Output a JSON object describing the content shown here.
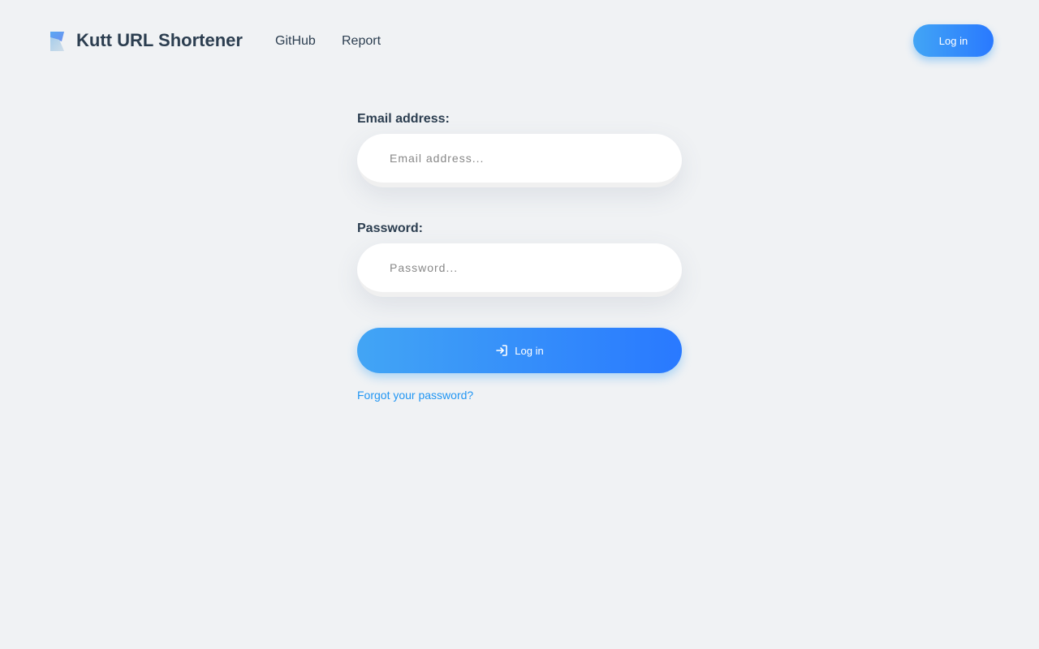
{
  "header": {
    "brand": "Kutt URL Shortener",
    "logo_icon": "kutt-logo-icon",
    "nav": [
      {
        "label": "GitHub"
      },
      {
        "label": "Report"
      }
    ],
    "login_label": "Log in"
  },
  "form": {
    "email": {
      "label": "Email address:",
      "value": "",
      "placeholder": "Email address..."
    },
    "password": {
      "label": "Password:",
      "value": "",
      "placeholder": "Password..."
    },
    "submit": {
      "label": "Log in",
      "icon": "login-icon"
    },
    "forgot_label": "Forgot your password?"
  },
  "colors": {
    "background": "#f0f2f4",
    "text": "#2c3e50",
    "accent_start": "#42a5f5",
    "accent_end": "#2979ff",
    "link": "#2196f3"
  }
}
